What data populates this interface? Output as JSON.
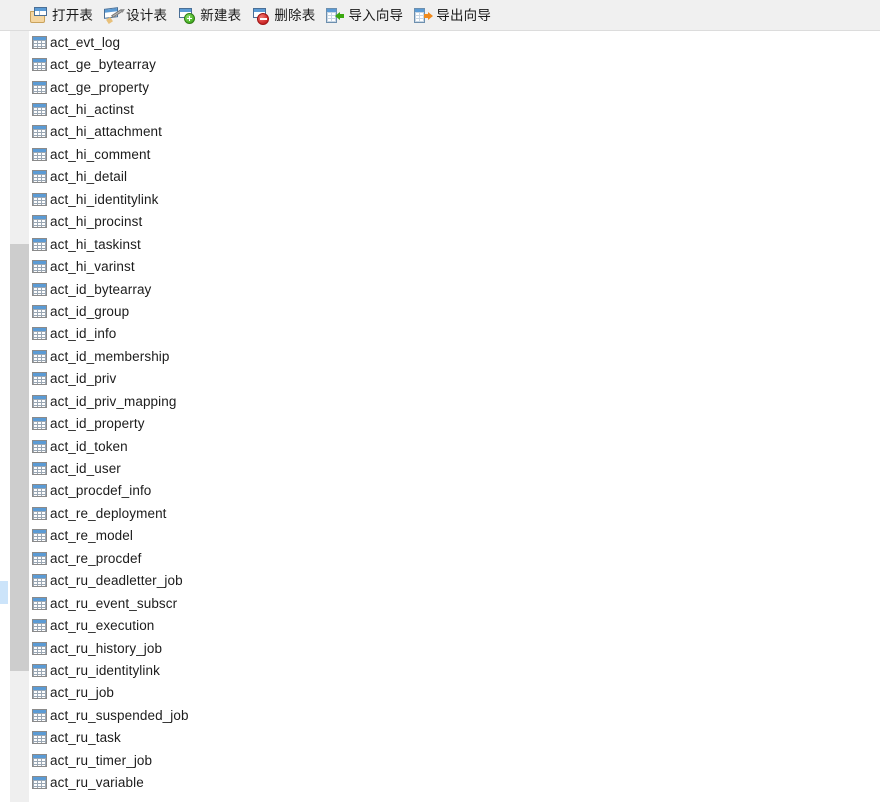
{
  "toolbar": {
    "items": [
      {
        "label": "打开表",
        "icon": "open-table-icon",
        "name": "open-table-button"
      },
      {
        "label": "设计表",
        "icon": "design-table-icon",
        "name": "design-table-button"
      },
      {
        "label": "新建表",
        "icon": "new-table-icon",
        "name": "new-table-button"
      },
      {
        "label": "删除表",
        "icon": "delete-table-icon",
        "name": "delete-table-button"
      },
      {
        "label": "导入向导",
        "icon": "import-wizard-icon",
        "name": "import-wizard-button"
      },
      {
        "label": "导出向导",
        "icon": "export-wizard-icon",
        "name": "export-wizard-button"
      }
    ]
  },
  "list": {
    "icon": "table-icon",
    "items": [
      "act_evt_log",
      "act_ge_bytearray",
      "act_ge_property",
      "act_hi_actinst",
      "act_hi_attachment",
      "act_hi_comment",
      "act_hi_detail",
      "act_hi_identitylink",
      "act_hi_procinst",
      "act_hi_taskinst",
      "act_hi_varinst",
      "act_id_bytearray",
      "act_id_group",
      "act_id_info",
      "act_id_membership",
      "act_id_priv",
      "act_id_priv_mapping",
      "act_id_property",
      "act_id_token",
      "act_id_user",
      "act_procdef_info",
      "act_re_deployment",
      "act_re_model",
      "act_re_procdef",
      "act_ru_deadletter_job",
      "act_ru_event_subscr",
      "act_ru_execution",
      "act_ru_history_job",
      "act_ru_identitylink",
      "act_ru_job",
      "act_ru_suspended_job",
      "act_ru_task",
      "act_ru_timer_job",
      "act_ru_variable"
    ]
  },
  "scrollbar": {
    "orientation": "vertical",
    "position": "left"
  },
  "colors": {
    "toolbar_background": "#f0f0f0",
    "list_background": "#ffffff",
    "table_icon_header": "#5b9bd5",
    "scroll_thumb": "#cdcdcd",
    "scroll_track": "#efefef",
    "row_marker": "#cce4fa",
    "text": "#1c1c1c"
  }
}
